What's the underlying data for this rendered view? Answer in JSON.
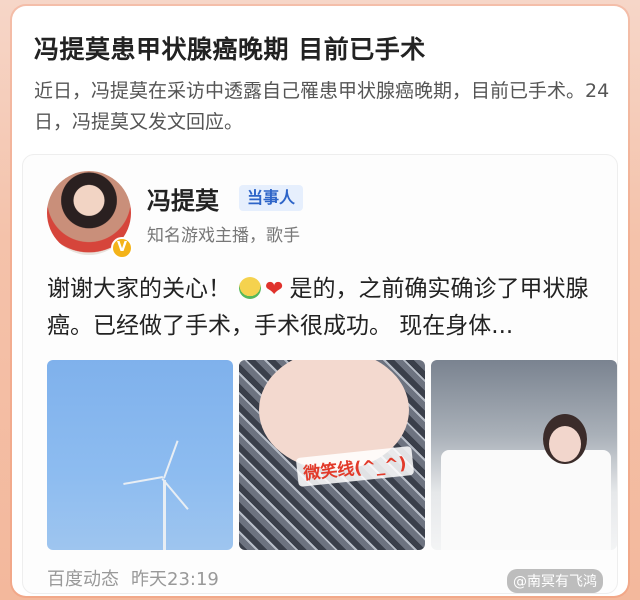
{
  "article": {
    "headline": "冯提莫患甲状腺癌晚期 目前已手术",
    "summary": "近日，冯提莫在采访中透露自己罹患甲状腺癌晚期，目前已手术。24日，冯提莫又发文回应。"
  },
  "post": {
    "author": {
      "name": "冯提莫",
      "badge": "当事人",
      "verify_mark": "V",
      "description": "知名游戏主播，歌手"
    },
    "text_before_emoji": "谢谢大家的关心！",
    "emoji": [
      "hug-emoji",
      "heart-emoji"
    ],
    "text_after_emoji": "是的，之前确实确诊了甲状腺癌。已经做了手术，手术很成功。 现在身体...",
    "photo_caption": "微笑线(^_^)",
    "footer": {
      "source": "百度动态",
      "time": "昨天23:19"
    },
    "watermark": "@南冥有飞鸿"
  },
  "colors": {
    "background": "#f4c2aa",
    "badge_bg": "#e6effd",
    "badge_text": "#2d64c8",
    "verify": "#f4b319"
  }
}
